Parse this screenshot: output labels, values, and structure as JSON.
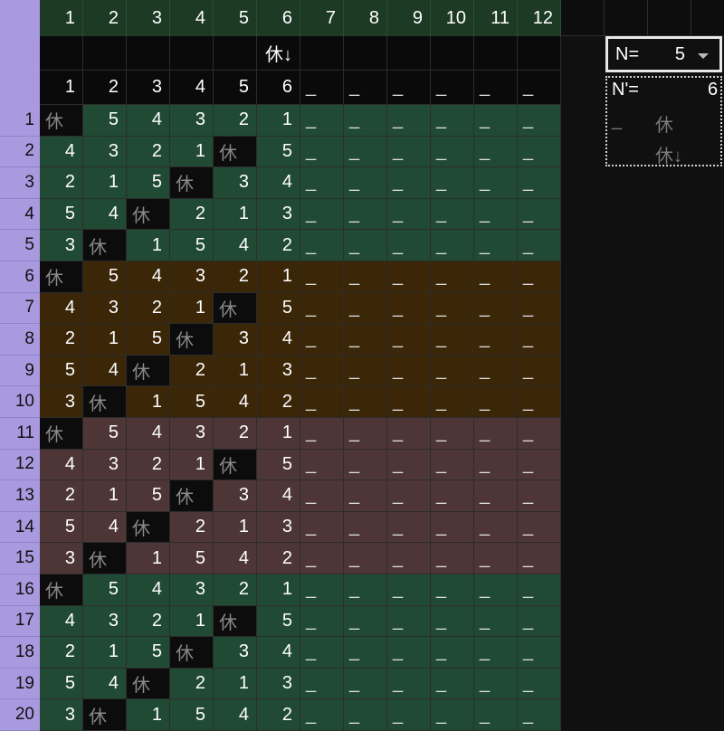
{
  "colors": {
    "row_header_bg": "#a99ae0",
    "col_header_bg": "#1d3a24",
    "group_green": "#214a35",
    "group_brown": "#3b2608",
    "group_red": "#4e3636",
    "rest_cell_bg": "#0c0c0c",
    "background": "#101010"
  },
  "sheet": {
    "column_headers": [
      "1",
      "2",
      "3",
      "4",
      "5",
      "6",
      "7",
      "8",
      "9",
      "10",
      "11",
      "12"
    ],
    "marker_row": [
      "",
      "",
      "",
      "",
      "",
      "休↓",
      "",
      "",
      "",
      "",
      "",
      ""
    ],
    "index_row": [
      "1",
      "2",
      "3",
      "4",
      "5",
      "6",
      "_",
      "_",
      "_",
      "_",
      "_",
      "_"
    ],
    "rest_symbol": "休",
    "rows": [
      {
        "num": "1",
        "group": "green",
        "cells": [
          "休",
          "5",
          "4",
          "3",
          "2",
          "1",
          "_",
          "_",
          "_",
          "_",
          "_",
          "_"
        ]
      },
      {
        "num": "2",
        "group": "green",
        "cells": [
          "4",
          "3",
          "2",
          "1",
          "休",
          "5",
          "_",
          "_",
          "_",
          "_",
          "_",
          "_"
        ]
      },
      {
        "num": "3",
        "group": "green",
        "cells": [
          "2",
          "1",
          "5",
          "休",
          "3",
          "4",
          "_",
          "_",
          "_",
          "_",
          "_",
          "_"
        ]
      },
      {
        "num": "4",
        "group": "green",
        "cells": [
          "5",
          "4",
          "休",
          "2",
          "1",
          "3",
          "_",
          "_",
          "_",
          "_",
          "_",
          "_"
        ]
      },
      {
        "num": "5",
        "group": "green",
        "cells": [
          "3",
          "休",
          "1",
          "5",
          "4",
          "2",
          "_",
          "_",
          "_",
          "_",
          "_",
          "_"
        ]
      },
      {
        "num": "6",
        "group": "brown",
        "cells": [
          "休",
          "5",
          "4",
          "3",
          "2",
          "1",
          "_",
          "_",
          "_",
          "_",
          "_",
          "_"
        ]
      },
      {
        "num": "7",
        "group": "brown",
        "cells": [
          "4",
          "3",
          "2",
          "1",
          "休",
          "5",
          "_",
          "_",
          "_",
          "_",
          "_",
          "_"
        ]
      },
      {
        "num": "8",
        "group": "brown",
        "cells": [
          "2",
          "1",
          "5",
          "休",
          "3",
          "4",
          "_",
          "_",
          "_",
          "_",
          "_",
          "_"
        ]
      },
      {
        "num": "9",
        "group": "brown",
        "cells": [
          "5",
          "4",
          "休",
          "2",
          "1",
          "3",
          "_",
          "_",
          "_",
          "_",
          "_",
          "_"
        ]
      },
      {
        "num": "10",
        "group": "brown",
        "cells": [
          "3",
          "休",
          "1",
          "5",
          "4",
          "2",
          "_",
          "_",
          "_",
          "_",
          "_",
          "_"
        ]
      },
      {
        "num": "11",
        "group": "red",
        "cells": [
          "休",
          "5",
          "4",
          "3",
          "2",
          "1",
          "_",
          "_",
          "_",
          "_",
          "_",
          "_"
        ]
      },
      {
        "num": "12",
        "group": "red",
        "cells": [
          "4",
          "3",
          "2",
          "1",
          "休",
          "5",
          "_",
          "_",
          "_",
          "_",
          "_",
          "_"
        ]
      },
      {
        "num": "13",
        "group": "red",
        "cells": [
          "2",
          "1",
          "5",
          "休",
          "3",
          "4",
          "_",
          "_",
          "_",
          "_",
          "_",
          "_"
        ]
      },
      {
        "num": "14",
        "group": "red",
        "cells": [
          "5",
          "4",
          "休",
          "2",
          "1",
          "3",
          "_",
          "_",
          "_",
          "_",
          "_",
          "_"
        ]
      },
      {
        "num": "15",
        "group": "red",
        "cells": [
          "3",
          "休",
          "1",
          "5",
          "4",
          "2",
          "_",
          "_",
          "_",
          "_",
          "_",
          "_"
        ]
      },
      {
        "num": "16",
        "group": "green",
        "cells": [
          "休",
          "5",
          "4",
          "3",
          "2",
          "1",
          "_",
          "_",
          "_",
          "_",
          "_",
          "_"
        ]
      },
      {
        "num": "17",
        "group": "green",
        "cells": [
          "4",
          "3",
          "2",
          "1",
          "休",
          "5",
          "_",
          "_",
          "_",
          "_",
          "_",
          "_"
        ]
      },
      {
        "num": "18",
        "group": "green",
        "cells": [
          "2",
          "1",
          "5",
          "休",
          "3",
          "4",
          "_",
          "_",
          "_",
          "_",
          "_",
          "_"
        ]
      },
      {
        "num": "19",
        "group": "green",
        "cells": [
          "5",
          "4",
          "休",
          "2",
          "1",
          "3",
          "_",
          "_",
          "_",
          "_",
          "_",
          "_"
        ]
      },
      {
        "num": "20",
        "group": "green",
        "cells": [
          "3",
          "休",
          "1",
          "5",
          "4",
          "2",
          "_",
          "_",
          "_",
          "_",
          "_",
          "_"
        ]
      }
    ]
  },
  "panel": {
    "n_label": "N=",
    "n_value": "5",
    "n_prime_label": "N'=",
    "n_prime_value": "6",
    "legend_blank": "_",
    "legend_rest": "休",
    "legend_rest_down": "休↓"
  }
}
